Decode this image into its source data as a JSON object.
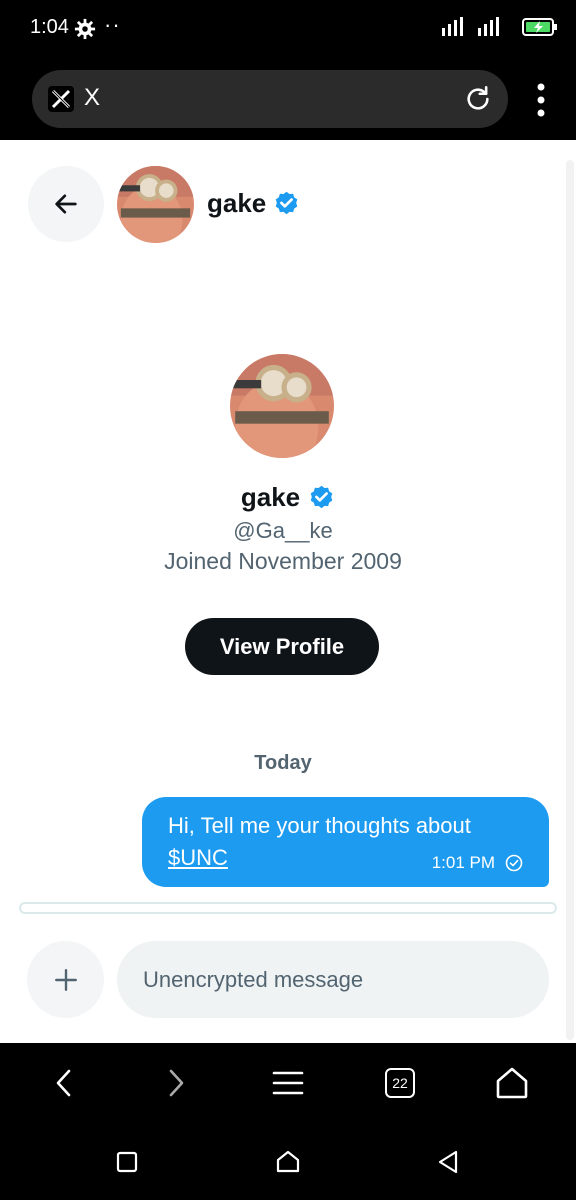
{
  "status_bar": {
    "time": "1:04",
    "dots": "··"
  },
  "browser": {
    "site_logo": "𝕏",
    "url": "X"
  },
  "header": {
    "name": "gake"
  },
  "profile": {
    "name": "gake",
    "handle": "@Ga__ke",
    "joined": "Joined November 2009",
    "view_profile_label": "View Profile"
  },
  "messages": {
    "day_label": "Today",
    "items": [
      {
        "text": "Hi, Tell me your thoughts about",
        "link": "$UNC",
        "time": "1:01 PM",
        "status": "sent"
      }
    ]
  },
  "composer": {
    "placeholder": "Unencrypted message"
  },
  "browser_nav": {
    "tab_count": "22"
  },
  "colors": {
    "accent": "#1d9bf0",
    "dark": "#0f1419",
    "muted": "#536471"
  },
  "icons": {
    "status": [
      "gear-icon",
      "signal-icon",
      "battery-charging-icon"
    ],
    "browser": [
      "x-logo-icon",
      "reload-icon",
      "more-vert-icon"
    ],
    "page": [
      "back-arrow-icon",
      "verified-badge-icon",
      "read-check-icon",
      "plus-icon"
    ],
    "browser_nav": [
      "back-icon",
      "forward-icon",
      "menu-icon",
      "tabs-icon",
      "home-icon"
    ],
    "system_nav": [
      "recents-icon",
      "home-icon",
      "back-icon"
    ]
  }
}
